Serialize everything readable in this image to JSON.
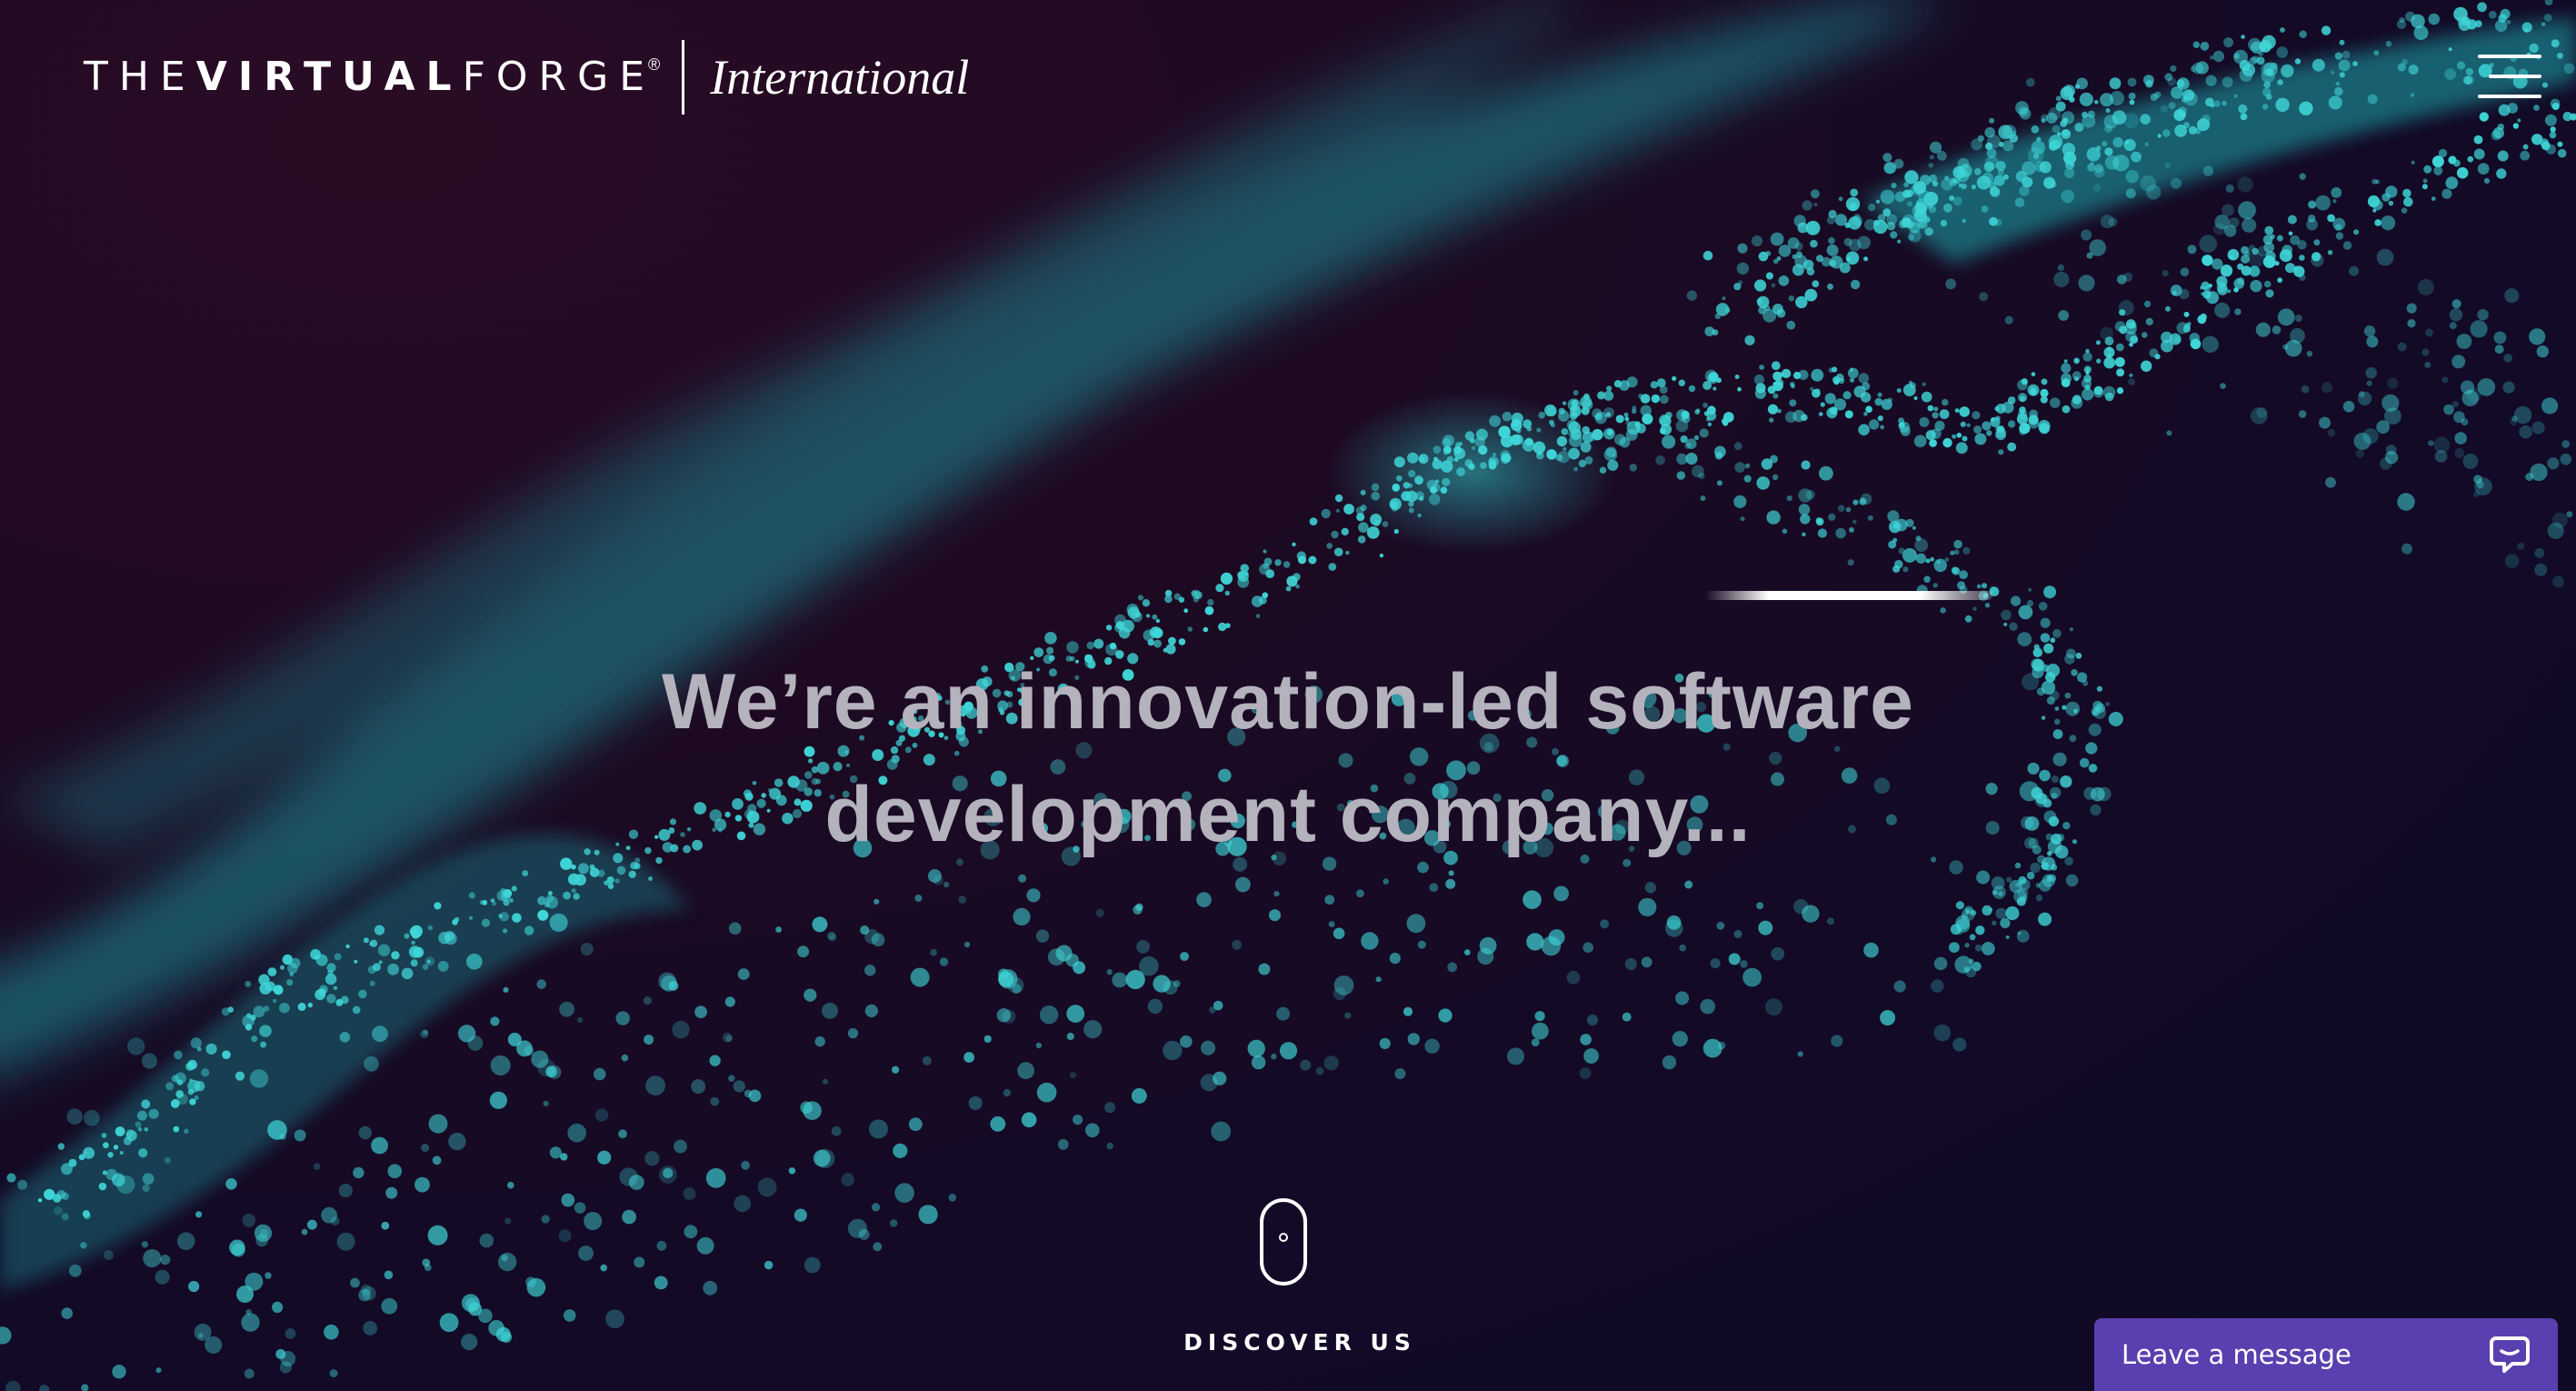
{
  "header": {
    "logo_main_light_1": "THE",
    "logo_main_bold": "VIRTUAL",
    "logo_main_light_2": "FORGE",
    "logo_registered": "®",
    "logo_sub": "International",
    "menu_icon": "hamburger-icon"
  },
  "hero": {
    "title_line_1": "We’re an innovation-led software",
    "title_line_2": "development company..."
  },
  "scroll": {
    "icon": "mouse-scroll-icon",
    "label": "DISCOVER US"
  },
  "chat": {
    "label": "Leave a message",
    "icon": "chat-bubble-icon"
  },
  "colors": {
    "background": "#120a22",
    "particles": "#3fd6d8",
    "hero_text": "#b4b2bc",
    "chat_bg": "#5a3fb0"
  }
}
